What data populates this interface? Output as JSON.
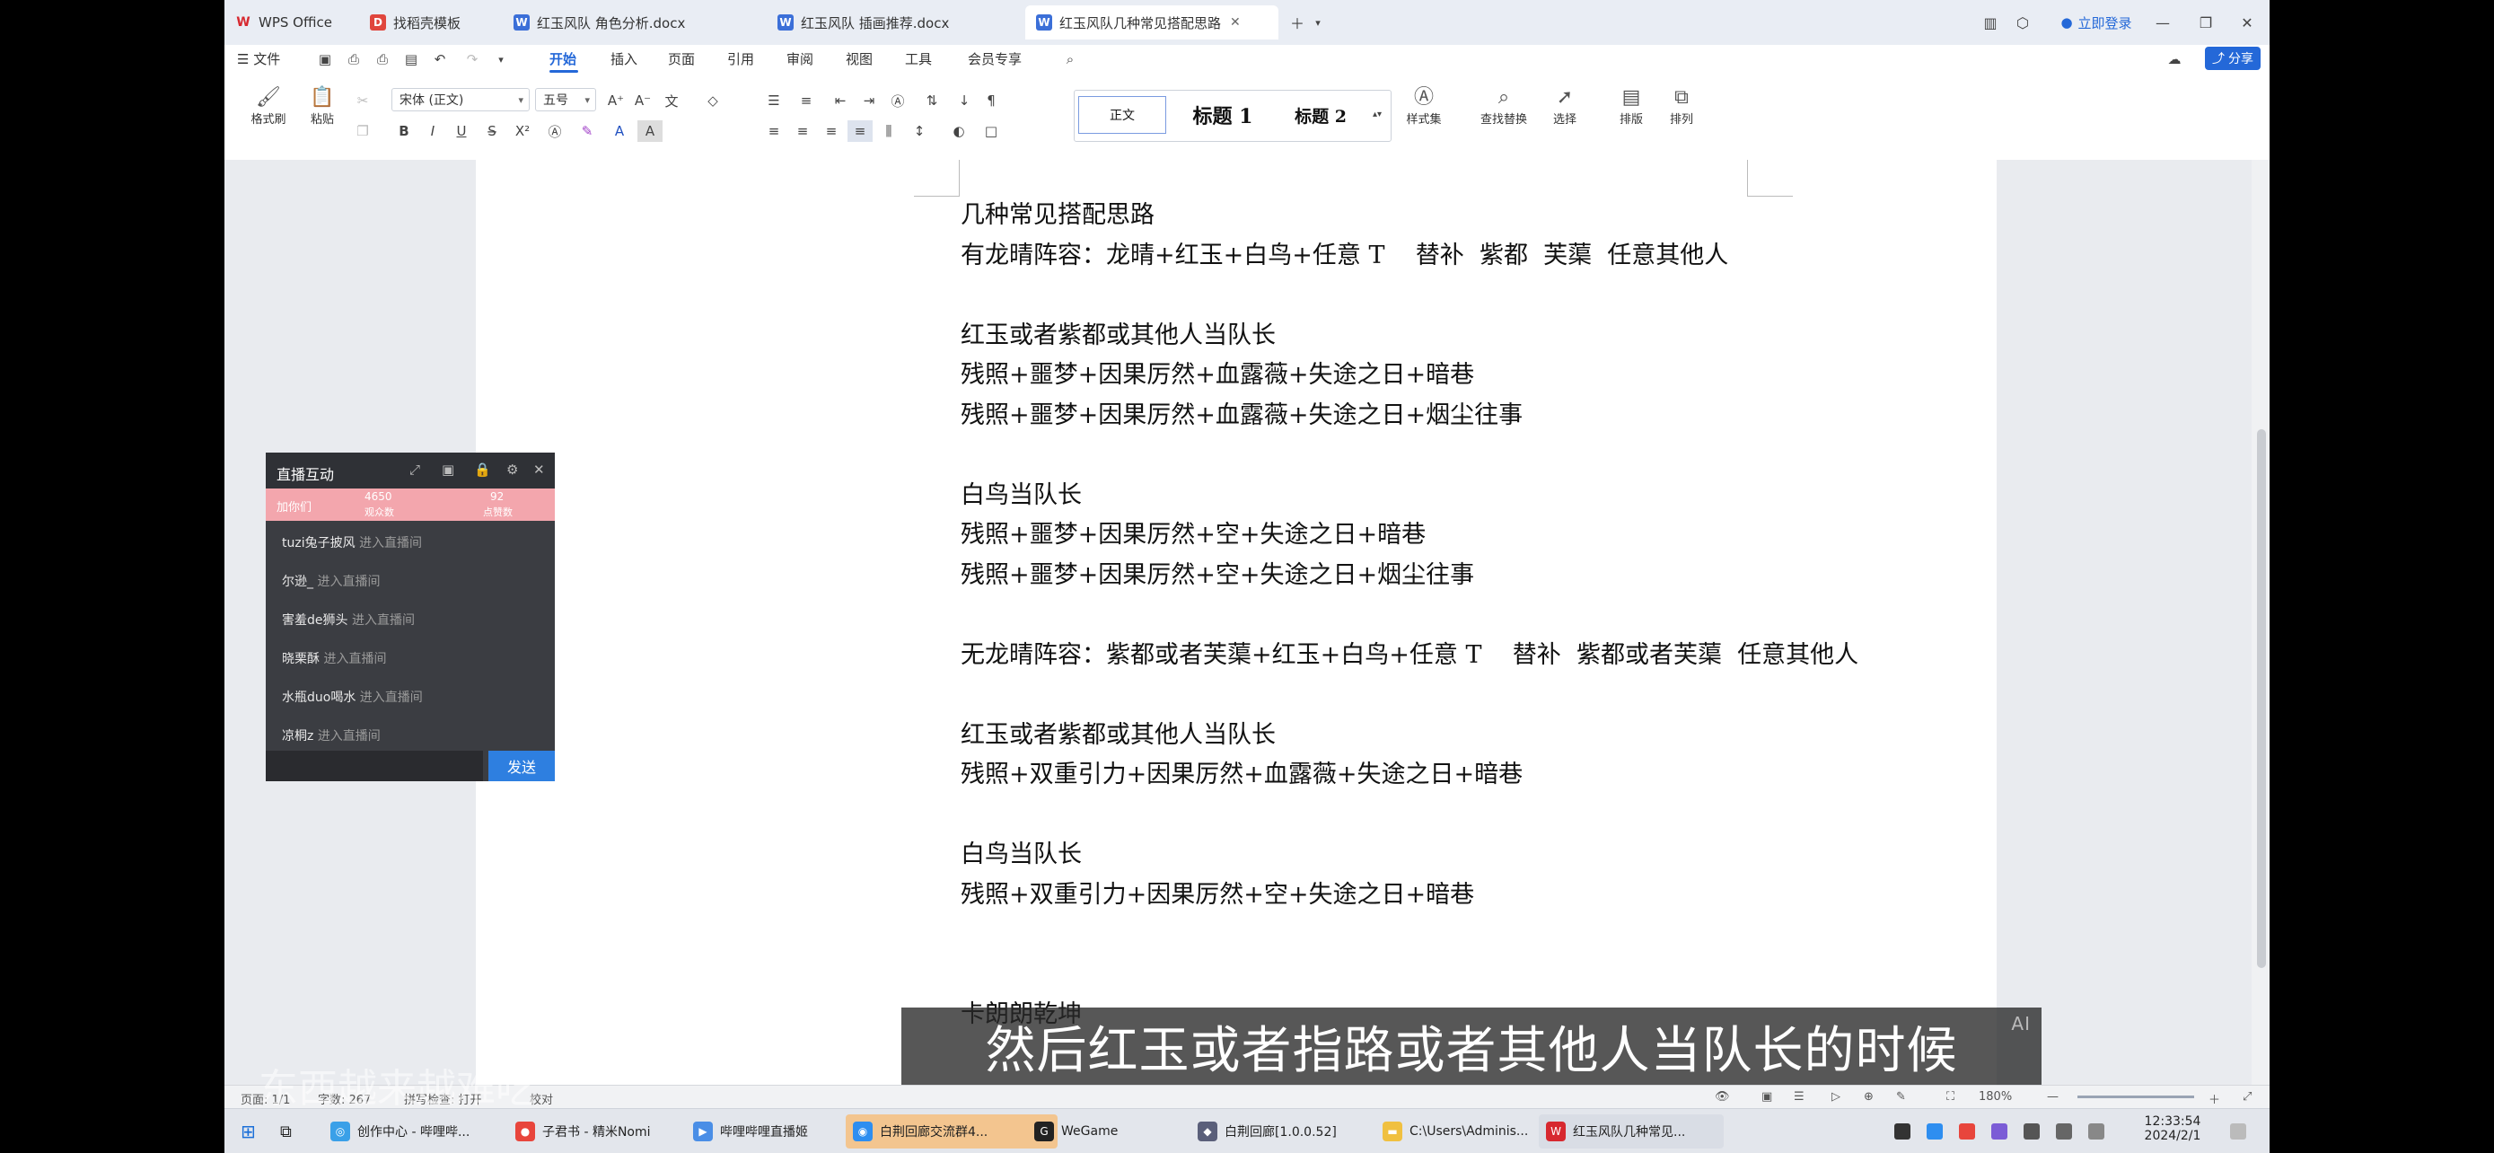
{
  "tabs": [
    {
      "label": "WPS Office",
      "icon": "wps-logo-icon"
    },
    {
      "label": "找稻壳模板",
      "icon": "pdf-icon"
    },
    {
      "label": "红玉风队 角色分析.docx",
      "icon": "word-doc-icon"
    },
    {
      "label": "红玉风队 插画推荐.docx",
      "icon": "word-doc-icon"
    },
    {
      "label": "红玉风队几种常见搭配思路.d",
      "icon": "word-doc-icon"
    }
  ],
  "login_label": "立即登录",
  "share_label": "分享",
  "menu": {
    "file_label": "文件",
    "items": [
      "开始",
      "插入",
      "页面",
      "引用",
      "审阅",
      "视图",
      "工具",
      "会员专享"
    ]
  },
  "ribbon": {
    "format_painter": "格式刷",
    "paste": "粘贴",
    "font_name": "宋体 (正文)",
    "font_size": "五号",
    "styles": [
      "正文",
      "标题 1",
      "标题 2"
    ],
    "style_set": "样式集",
    "find_replace": "查找替换",
    "select": "选择",
    "layout": "排版",
    "arrange": "排列"
  },
  "document": {
    "lines": [
      "几种常见搭配思路",
      "有龙晴阵容：龙晴+红玉+白鸟+任意 T    替补  紫都  芙蕖  任意其他人",
      "",
      "红玉或者紫都或其他人当队长",
      "残照+噩梦+因果厉然+血露薇+失途之日+暗巷",
      "残照+噩梦+因果厉然+血露薇+失途之日+烟尘往事",
      "",
      "白鸟当队长",
      "残照+噩梦+因果厉然+空+失途之日+暗巷",
      "残照+噩梦+因果厉然+空+失途之日+烟尘往事",
      "",
      "无龙晴阵容：紫都或者芙蕖+红玉+白鸟+任意 T    替补  紫都或者芙蕖  任意其他人",
      "",
      "红玉或者紫都或其他人当队长",
      "残照+双重引力+因果厉然+血露薇+失途之日+暗巷",
      "",
      "白鸟当队长",
      "残照+双重引力+因果厉然+空+失途之日+暗巷",
      "",
      "",
      "卡朗朗乾坤"
    ]
  },
  "live_panel": {
    "title": "直播互动",
    "tab_label": "加你们",
    "stat1_value": "4650",
    "stat1_label": "观众数",
    "stat2_value": "92",
    "stat2_label": "点赞数",
    "rows": [
      {
        "user": "tuzi兔子披风",
        "action": "进入直播间"
      },
      {
        "user": "尔逊_",
        "action": "进入直播间"
      },
      {
        "user": "害羞de狮头",
        "action": "进入直播间"
      },
      {
        "user": "晓栗酥",
        "action": "进入直播间"
      },
      {
        "user": "水瓶duo喝水",
        "action": "进入直播间"
      },
      {
        "user": "凉桐z",
        "action": "进入直播间"
      }
    ],
    "send_label": "发送"
  },
  "subtitle": "然后红玉或者指路或者其他人当队长的时候",
  "subtitle_badge": "AI",
  "watermark": "东西越来越难吃",
  "statusbar": {
    "page": "页面: 1/1",
    "words": "字数: 267",
    "spell": "拼写检查: 打开",
    "proof": "校对",
    "zoom": "180%"
  },
  "taskbar": [
    {
      "label": "创作中心 - 哔哩哔...",
      "color": "#3aa0e8"
    },
    {
      "label": "子君书 - 精米Nomi",
      "color": "#e8453c"
    },
    {
      "label": "哔哩哔哩直播姬",
      "color": "#4a8ee6"
    },
    {
      "label": "白荆回廊交流群4...",
      "color": "#2e8ef0"
    },
    {
      "label": "WeGame",
      "color": "#222222"
    },
    {
      "label": "白荆回廊[1.0.0.52]",
      "color": "#5a5f7a"
    },
    {
      "label": "C:\\Users\\Adminis...",
      "color": "#f0c040"
    },
    {
      "label": "红玉风队几种常见...",
      "color": "#d7282f"
    }
  ],
  "clock_time": "12:33:54",
  "clock_date": "2024/2/1",
  "colors": {
    "accent": "#2468d8",
    "wps_red": "#d7282f",
    "active_task": "#f3c58f",
    "live_pink": "#f3a6ad",
    "send_blue": "#2e7fe0"
  }
}
